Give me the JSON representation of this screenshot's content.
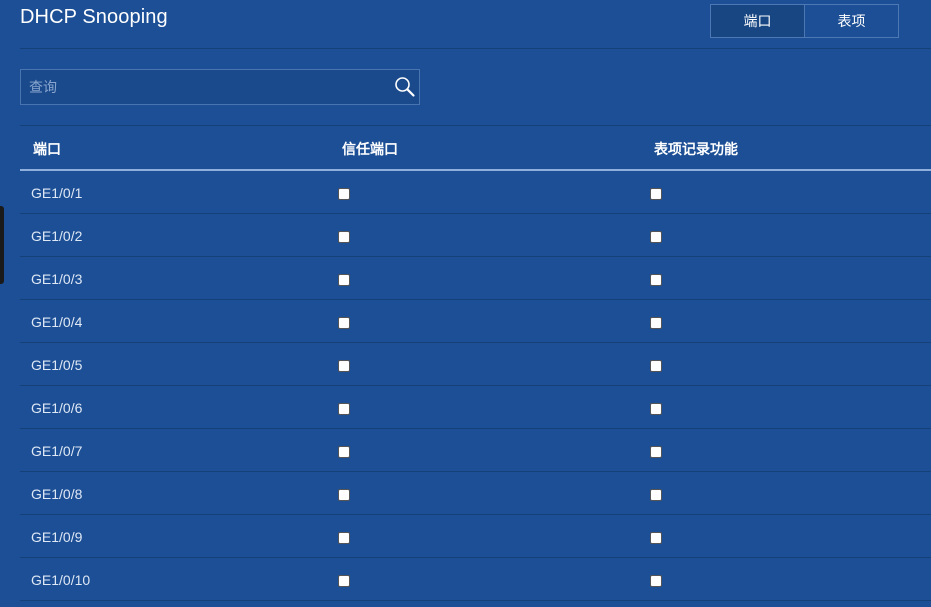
{
  "title": "DHCP Snooping",
  "tabs": [
    {
      "label": "端口",
      "active": true
    },
    {
      "label": "表项",
      "active": false
    }
  ],
  "search": {
    "placeholder": "查询",
    "value": ""
  },
  "table": {
    "columns": [
      "端口",
      "信任端口",
      "表项记录功能"
    ],
    "rows": [
      {
        "port": "GE1/0/1",
        "trusted": false,
        "record": false
      },
      {
        "port": "GE1/0/2",
        "trusted": false,
        "record": false
      },
      {
        "port": "GE1/0/3",
        "trusted": false,
        "record": false
      },
      {
        "port": "GE1/0/4",
        "trusted": false,
        "record": false
      },
      {
        "port": "GE1/0/5",
        "trusted": false,
        "record": false
      },
      {
        "port": "GE1/0/6",
        "trusted": false,
        "record": false
      },
      {
        "port": "GE1/0/7",
        "trusted": false,
        "record": false
      },
      {
        "port": "GE1/0/8",
        "trusted": false,
        "record": false
      },
      {
        "port": "GE1/0/9",
        "trusted": false,
        "record": false
      },
      {
        "port": "GE1/0/10",
        "trusted": false,
        "record": false
      }
    ]
  },
  "colors": {
    "background": "#1c4f95",
    "active_tab": "#174683",
    "header_underline": "#8fb0dc"
  }
}
